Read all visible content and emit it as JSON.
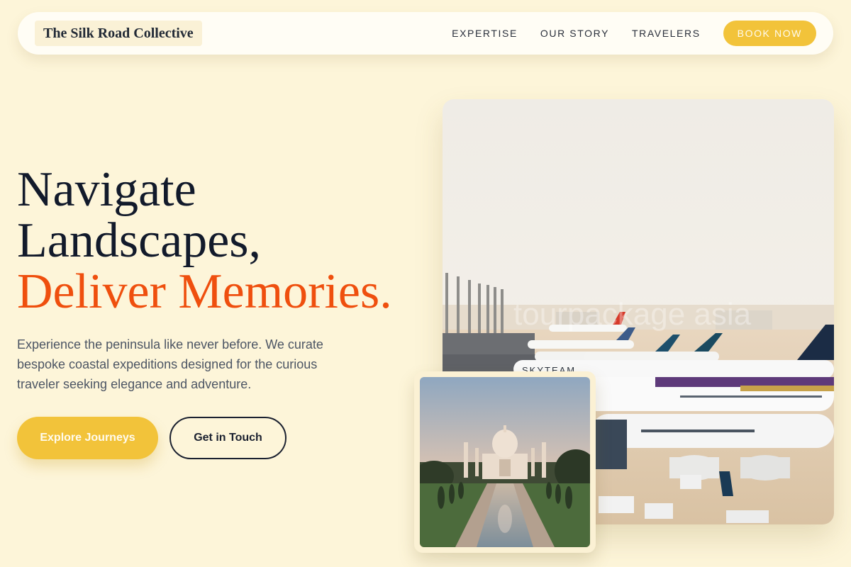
{
  "nav": {
    "brand": "The Silk Road Collective",
    "links": [
      "EXPERTISE",
      "OUR STORY",
      "TRAVELERS"
    ],
    "cta": "BOOK NOW"
  },
  "hero": {
    "title_line1": "Navigate",
    "title_line2": "Landscapes,",
    "title_accent": "Deliver Memories.",
    "subtitle": "Experience the peninsula like never before. We curate bespoke coastal expeditions designed for the curious traveler seeking elegance and adventure.",
    "primary_button": "Explore Journeys",
    "secondary_button": "Get in Touch"
  },
  "images": {
    "main": {
      "alt": "Airport apron with airliners at gates",
      "fuselage_text": "SKYTEAM",
      "watermark": "tourpackage asia"
    },
    "inset": {
      "alt": "Taj Mahal at sunrise with reflecting pool"
    }
  },
  "colors": {
    "background": "#fdf5d9",
    "accent_yellow": "#f2c33a",
    "accent_orange": "#ef4f0e",
    "text_dark": "#121a2b"
  }
}
